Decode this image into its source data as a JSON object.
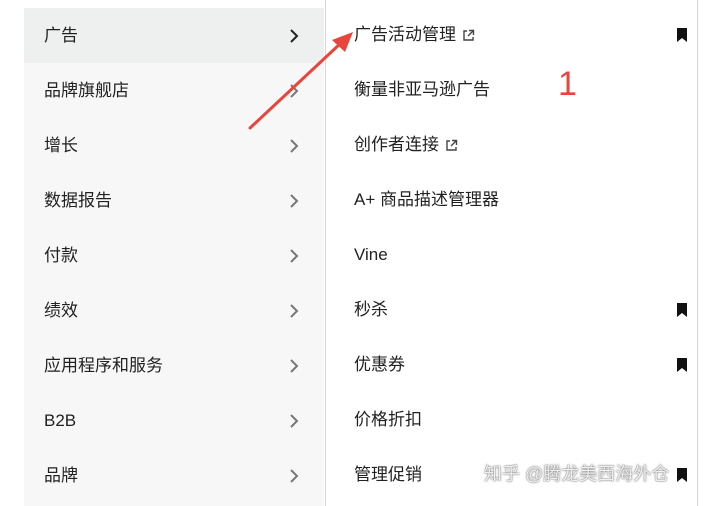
{
  "left_menu": {
    "items": [
      {
        "label": "广告"
      },
      {
        "label": "品牌旗舰店"
      },
      {
        "label": "增长"
      },
      {
        "label": "数据报告"
      },
      {
        "label": "付款"
      },
      {
        "label": "绩效"
      },
      {
        "label": "应用程序和服务"
      },
      {
        "label": "B2B"
      },
      {
        "label": "品牌"
      }
    ],
    "active_index": 0
  },
  "right_menu": {
    "items": [
      {
        "label": "广告活动管理",
        "external": true,
        "bookmarked": true
      },
      {
        "label": "衡量非亚马逊广告",
        "external": false,
        "bookmarked": false
      },
      {
        "label": "创作者连接",
        "external": true,
        "bookmarked": false
      },
      {
        "label": "A+ 商品描述管理器",
        "external": false,
        "bookmarked": false
      },
      {
        "label": "Vine",
        "external": false,
        "bookmarked": false
      },
      {
        "label": "秒杀",
        "external": false,
        "bookmarked": true
      },
      {
        "label": "优惠券",
        "external": false,
        "bookmarked": true
      },
      {
        "label": "价格折扣",
        "external": false,
        "bookmarked": false
      },
      {
        "label": "管理促销",
        "external": false,
        "bookmarked": true
      }
    ]
  },
  "annotation": {
    "number": "1",
    "color": "#e8453c"
  },
  "watermark": {
    "text": "知乎 @腾龙美西海外仓"
  },
  "icons": {
    "chevron": "chevron-right-icon",
    "external": "external-link-icon",
    "bookmark": "bookmark-icon"
  }
}
